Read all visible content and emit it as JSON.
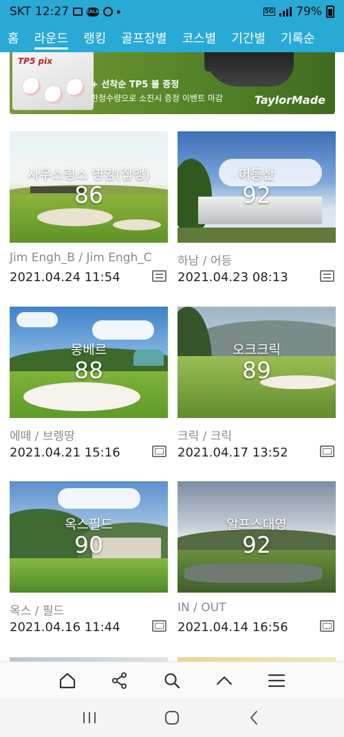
{
  "status_bar": {
    "carrier": "SKT",
    "time": "12:27",
    "network": "5G",
    "battery": "79%"
  },
  "tabs": [
    {
      "label": "홈"
    },
    {
      "label": "라운드"
    },
    {
      "label": "랭킹"
    },
    {
      "label": "골프장별"
    },
    {
      "label": "코스별"
    },
    {
      "label": "기간별"
    },
    {
      "label": "기록순"
    }
  ],
  "active_tab": "라운드",
  "banner": {
    "product": "TP5 pix",
    "line1": "+ 선착순 TP5 볼 증정",
    "line2": "한정수량으로 소진시 증정 이벤트 마감",
    "logo": "TaylorMade"
  },
  "rounds": [
    {
      "course": "사우스링스 영암(집앵)",
      "score": "86",
      "players": "Jim Engh_B / Jim Engh_C",
      "date": "2021.04.24 11:54",
      "icon": "scorecard-icon"
    },
    {
      "course": "어등산",
      "score": "92",
      "players": "하남 / 어등",
      "date": "2021.04.23 08:13",
      "icon": "scorecard-icon"
    },
    {
      "course": "몽베르",
      "score": "88",
      "players": "에떼 / 브렝땅",
      "date": "2021.04.21 15:16",
      "icon": "photo-frame-icon"
    },
    {
      "course": "오크크릭",
      "score": "89",
      "players": "크릭 / 크릭",
      "date": "2021.04.17 13:52",
      "icon": "photo-frame-icon"
    },
    {
      "course": "옥스필드",
      "score": "90",
      "players": "옥스 / 필드",
      "date": "2021.04.16 11:44",
      "icon": "photo-frame-icon"
    },
    {
      "course": "알프스대영",
      "score": "92",
      "players": "IN / OUT",
      "date": "2021.04.14 16:56",
      "icon": "photo-frame-icon"
    }
  ],
  "toolbar": [
    "home-icon",
    "share-icon",
    "search-icon",
    "scroll-up-icon",
    "menu-icon"
  ],
  "navbar": [
    "recent-apps-icon",
    "home-button-icon",
    "back-icon"
  ],
  "colors": {
    "accent": "#29a9d6"
  }
}
